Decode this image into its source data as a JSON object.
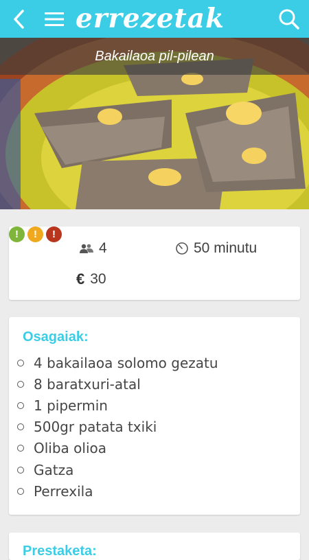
{
  "app": {
    "logo_text": "errezetak"
  },
  "header": {
    "back_icon": "chevron-left-icon",
    "menu_icon": "hamburger-menu-icon",
    "search_icon": "search-icon"
  },
  "recipe": {
    "title": "Bakailaoa pil-pilean",
    "image": "cod in pil-pil sauce in clay dish",
    "servings": "4",
    "time": "50 minutu",
    "cost": "30",
    "currency": "€",
    "difficulty": [
      {
        "color": "#7fb53a",
        "symbol": "!"
      },
      {
        "color": "#f0a81c",
        "symbol": "!"
      },
      {
        "color": "#b7361d",
        "symbol": "!"
      }
    ]
  },
  "ingredients": {
    "title": "Osagaiak:",
    "items": [
      "4 bakailaoa solomo gezatu",
      "8 baratxuri-atal",
      "1 pipermin",
      "500gr patata txiki",
      "Oliba olioa",
      "Gatza",
      "Perrexila"
    ]
  },
  "next_section": {
    "title": "Prestaketa:"
  },
  "colors": {
    "accent": "#3ccde6",
    "background": "#ececec",
    "card": "#ffffff"
  }
}
